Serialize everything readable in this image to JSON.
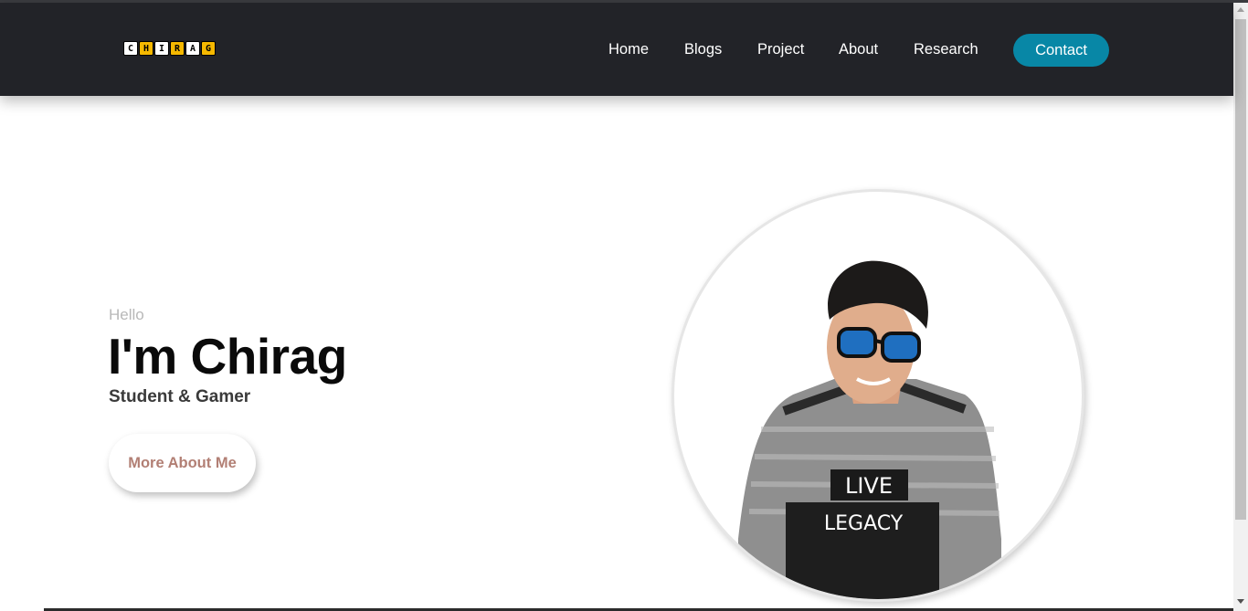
{
  "navbar": {
    "logo_letters": [
      "C",
      "H",
      "I",
      "R",
      "A",
      "G"
    ],
    "links": [
      "Home",
      "Blogs",
      "Project",
      "About",
      "Research"
    ],
    "contact_label": "Contact"
  },
  "hero": {
    "greeting": "Hello",
    "title": "I'm Chirag",
    "subtitle": "Student & Gamer",
    "cta_label": "More About Me"
  },
  "profile_photo": {
    "shirt_text_1": "LIVE",
    "shirt_text_2": "LEGACY"
  },
  "colors": {
    "navbar_bg": "#222328",
    "accent": "#0887a6",
    "cta_text": "#b27f74",
    "logo_yellow": "#f5b800"
  }
}
